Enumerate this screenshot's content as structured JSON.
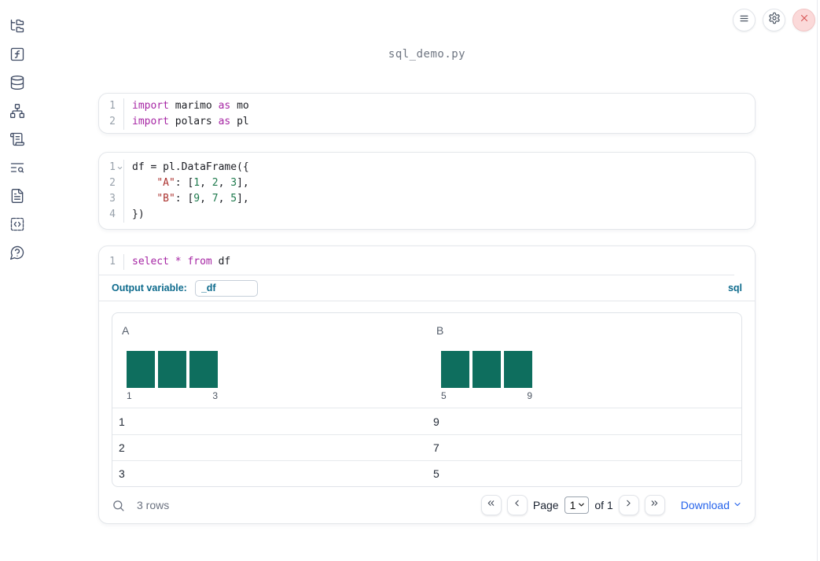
{
  "app": {
    "title": "sql_demo.py"
  },
  "colors": {
    "accent_sql": "#0e6b8d",
    "histogram_bar": "#0e6e5e",
    "download_link": "#2563eb",
    "close_button": "#d95757",
    "keyword": "#a626a4",
    "string": "#ac3431",
    "number": "#1e7a4d"
  },
  "topbar": {
    "buttons": [
      {
        "name": "menu",
        "icon": "hamburger-menu-icon"
      },
      {
        "name": "settings",
        "icon": "gear-icon"
      },
      {
        "name": "shutdown",
        "icon": "close-icon"
      }
    ]
  },
  "sidebar": {
    "items": [
      {
        "name": "file-explorer",
        "icon": "folder-tree-icon"
      },
      {
        "name": "variables",
        "icon": "function-square-icon"
      },
      {
        "name": "data-sources",
        "icon": "database-icon"
      },
      {
        "name": "dependency-graph",
        "icon": "network-icon"
      },
      {
        "name": "outline",
        "icon": "scroll-text-icon"
      },
      {
        "name": "logs",
        "icon": "list-search-icon"
      },
      {
        "name": "documentation",
        "icon": "file-text-icon"
      },
      {
        "name": "snippets",
        "icon": "code-square-icon"
      },
      {
        "name": "help",
        "icon": "help-circle-icon"
      }
    ]
  },
  "cells": [
    {
      "kind": "python",
      "lines": [
        {
          "num": "1",
          "tokens": [
            [
              "kw",
              "import"
            ],
            [
              "plain",
              " marimo "
            ],
            [
              "kw",
              "as"
            ],
            [
              "plain",
              " mo"
            ]
          ]
        },
        {
          "num": "2",
          "tokens": [
            [
              "kw",
              "import"
            ],
            [
              "plain",
              " polars "
            ],
            [
              "kw",
              "as"
            ],
            [
              "plain",
              " pl"
            ]
          ]
        }
      ]
    },
    {
      "kind": "python",
      "lines": [
        {
          "num": "1",
          "fold": true,
          "tokens": [
            [
              "plain",
              "df = pl.DataFrame({"
            ]
          ]
        },
        {
          "num": "2",
          "tokens": [
            [
              "plain",
              "    "
            ],
            [
              "str",
              "\"A\""
            ],
            [
              "plain",
              ": ["
            ],
            [
              "num",
              "1"
            ],
            [
              "plain",
              ", "
            ],
            [
              "num",
              "2"
            ],
            [
              "plain",
              ", "
            ],
            [
              "num",
              "3"
            ],
            [
              "plain",
              "],"
            ]
          ]
        },
        {
          "num": "3",
          "tokens": [
            [
              "plain",
              "    "
            ],
            [
              "str",
              "\"B\""
            ],
            [
              "plain",
              ": ["
            ],
            [
              "num",
              "9"
            ],
            [
              "plain",
              ", "
            ],
            [
              "num",
              "7"
            ],
            [
              "plain",
              ", "
            ],
            [
              "num",
              "5"
            ],
            [
              "plain",
              "],"
            ]
          ]
        },
        {
          "num": "4",
          "tokens": [
            [
              "plain",
              "})"
            ]
          ]
        }
      ]
    },
    {
      "kind": "sql",
      "lines": [
        {
          "num": "1",
          "tokens": [
            [
              "kw",
              "select"
            ],
            [
              "plain",
              " "
            ],
            [
              "kw",
              "*"
            ],
            [
              "plain",
              " "
            ],
            [
              "kw",
              "from"
            ],
            [
              "plain",
              " df"
            ]
          ]
        }
      ],
      "output_variable_label": "Output variable:",
      "output_variable_value": "_df",
      "language_badge": "sql"
    }
  ],
  "table": {
    "columns": [
      {
        "label": "A",
        "histogram": {
          "bars": [
            1,
            1,
            1
          ],
          "min_label": "1",
          "max_label": "3"
        }
      },
      {
        "label": "B",
        "histogram": {
          "bars": [
            1,
            1,
            1
          ],
          "min_label": "5",
          "max_label": "9"
        }
      }
    ],
    "rows": [
      [
        "1",
        "9"
      ],
      [
        "2",
        "7"
      ],
      [
        "3",
        "5"
      ]
    ],
    "footer": {
      "row_count": "3 rows",
      "search_icon": "search-icon",
      "pagination_icons": [
        "first-page-icon",
        "prev-page-icon",
        "next-page-icon",
        "last-page-icon"
      ],
      "page_label": "Page",
      "page_value": "1",
      "page_total": "of 1",
      "download_label": "Download"
    }
  },
  "chart_data": [
    {
      "type": "bar",
      "title": "A",
      "categories": [
        "bin1",
        "bin2",
        "bin3"
      ],
      "values": [
        1,
        1,
        1
      ],
      "xlabel": "",
      "ylabel": "",
      "x_range_labels": [
        "1",
        "3"
      ]
    },
    {
      "type": "bar",
      "title": "B",
      "categories": [
        "bin1",
        "bin2",
        "bin3"
      ],
      "values": [
        1,
        1,
        1
      ],
      "xlabel": "",
      "ylabel": "",
      "x_range_labels": [
        "5",
        "9"
      ]
    }
  ]
}
